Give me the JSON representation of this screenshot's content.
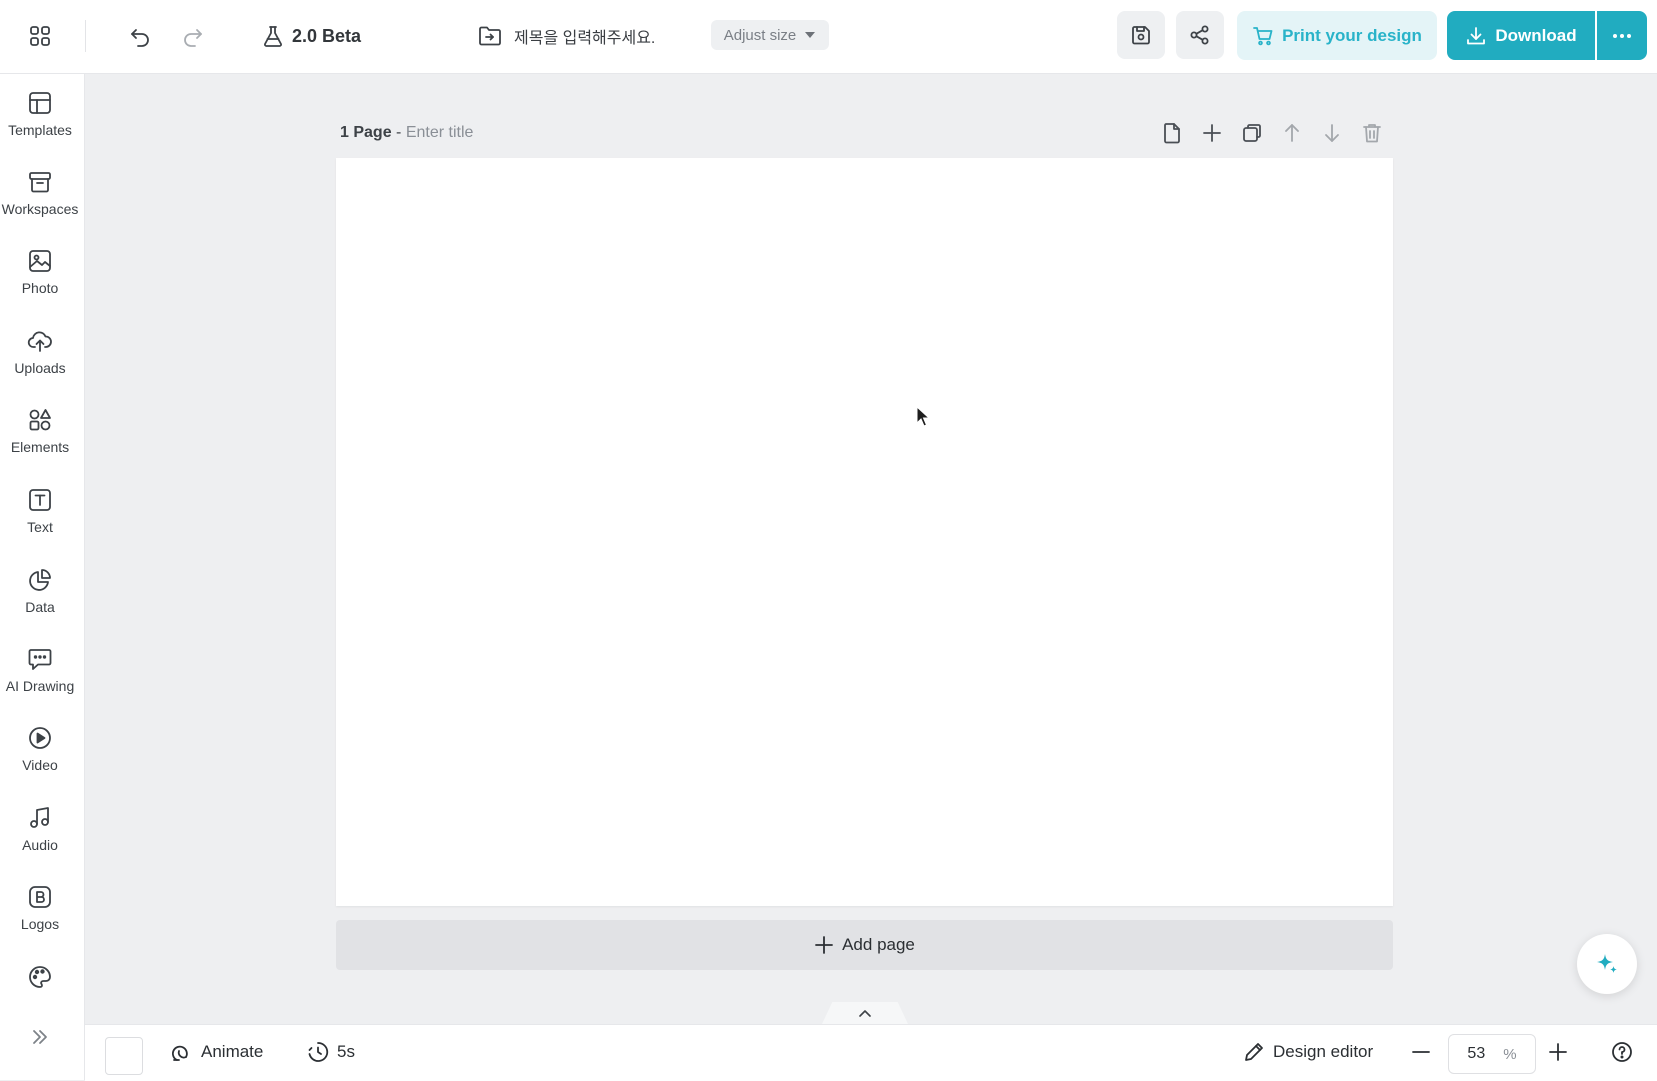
{
  "topbar": {
    "version_label": "2.0 Beta",
    "doc_title": "제목을 입력해주세요.",
    "adjust_size_label": "Adjust size",
    "print_label": "Print your design",
    "download_label": "Download"
  },
  "sidebar": {
    "items": [
      {
        "label": "Templates",
        "icon": "layout-icon"
      },
      {
        "label": "Workspaces",
        "icon": "archive-icon"
      },
      {
        "label": "Photo",
        "icon": "image-icon"
      },
      {
        "label": "Uploads",
        "icon": "cloud-upload-icon"
      },
      {
        "label": "Elements",
        "icon": "shapes-icon"
      },
      {
        "label": "Text",
        "icon": "text-icon"
      },
      {
        "label": "Data",
        "icon": "chart-icon"
      },
      {
        "label": "AI Drawing",
        "icon": "ai-chat-icon"
      },
      {
        "label": "Video",
        "icon": "play-icon"
      },
      {
        "label": "Audio",
        "icon": "music-icon"
      },
      {
        "label": "Logos",
        "icon": "logo-b-icon"
      }
    ]
  },
  "page": {
    "number_label": "1 Page",
    "separator": " - ",
    "title_placeholder": "Enter title",
    "add_page_label": "Add page"
  },
  "bottombar": {
    "animate_label": "Animate",
    "duration_label": "5s",
    "design_editor_label": "Design editor",
    "zoom_value": "53",
    "zoom_unit": "%"
  },
  "colors": {
    "accent": "#21acc0",
    "print_bg": "#e4f4f7",
    "print_text": "#29b3c9",
    "workspace_bg": "#eeeff1"
  }
}
